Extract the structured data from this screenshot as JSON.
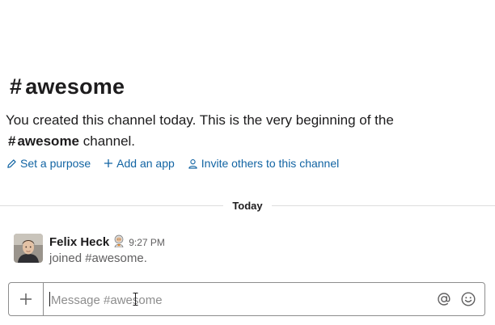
{
  "channel": {
    "hash": "#",
    "name": "awesome"
  },
  "intro": {
    "text_before": "You created this channel today. This is the very beginning of the",
    "hash": "#",
    "channel_name": "awesome",
    "text_after": "channel."
  },
  "actions": {
    "set_purpose": "Set a purpose",
    "add_app": "Add an app",
    "invite": "Invite others to this channel"
  },
  "divider": {
    "label": "Today"
  },
  "message": {
    "author": "Felix Heck",
    "status_icon": "astronaut-emoji",
    "time": "9:27 PM",
    "text": "joined #awesome."
  },
  "composer": {
    "placeholder": "Message #awesome"
  },
  "colors": {
    "link": "#1264a3",
    "text": "#1d1c1d",
    "muted": "#616061",
    "border": "#8d8d8d"
  }
}
